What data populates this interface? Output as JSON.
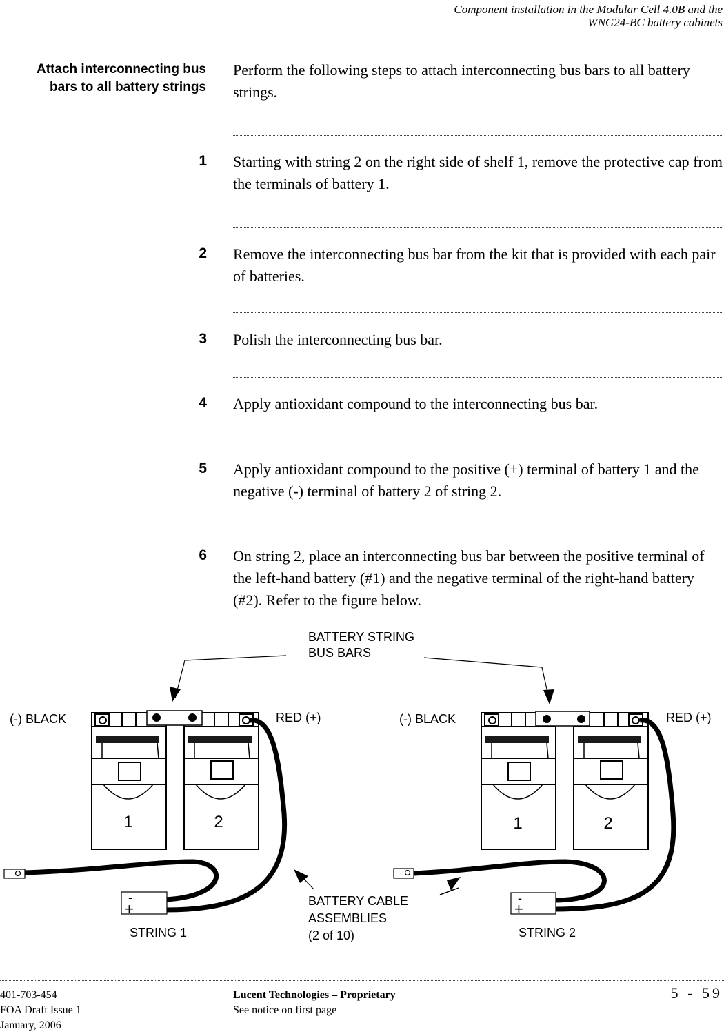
{
  "header": {
    "line1": "Component installation in the Modular Cell 4.0B and the",
    "line2": "WNG24-BC battery cabinets"
  },
  "section": {
    "title_line1": "Attach interconnecting bus",
    "title_line2": "bars to all battery strings",
    "intro": "Perform the following steps to attach interconnecting bus bars to all battery strings."
  },
  "steps": [
    {
      "num": "1",
      "text": "Starting with string 2 on the right side of shelf 1, remove the protective cap from the terminals of battery 1."
    },
    {
      "num": "2",
      "text": "Remove the interconnecting bus bar from the kit that is provided with each pair of batteries."
    },
    {
      "num": "3",
      "text": "Polish the interconnecting bus bar."
    },
    {
      "num": "4",
      "text": "Apply antioxidant compound to the interconnecting bus bar."
    },
    {
      "num": "5",
      "text": "Apply antioxidant compound to the positive (+) terminal of battery 1 and the negative (-) terminal of battery 2 of string 2."
    },
    {
      "num": "6",
      "text": "On string 2, place an interconnecting bus bar between the positive terminal of the left-hand battery (#1) and the negative terminal of the right-hand battery (#2). Refer to the figure below."
    }
  ],
  "figure": {
    "bus_bars_label_line1": "BATTERY STRING",
    "bus_bars_label_line2": "BUS BARS",
    "cable_label_line1": "BATTERY CABLE",
    "cable_label_line2": "ASSEMBLIES",
    "cable_label_line3": "(2 of 10)",
    "strings": [
      {
        "name": "STRING 1",
        "neg_label": "(-) BLACK",
        "pos_label": "RED (+)",
        "battery_labels": [
          "1",
          "2"
        ],
        "connector_minus": "-",
        "connector_plus": "+"
      },
      {
        "name": "STRING 2",
        "neg_label": "(-) BLACK",
        "pos_label": "RED (+)",
        "battery_labels": [
          "1",
          "2"
        ],
        "connector_minus": "-",
        "connector_plus": "+"
      }
    ]
  },
  "footer": {
    "doc_number": "401-703-454",
    "issue": "FOA Draft Issue 1",
    "date": "January, 2006",
    "company": "Lucent Technologies – Proprietary",
    "notice": "See notice on first page",
    "page": "5 - 59"
  }
}
